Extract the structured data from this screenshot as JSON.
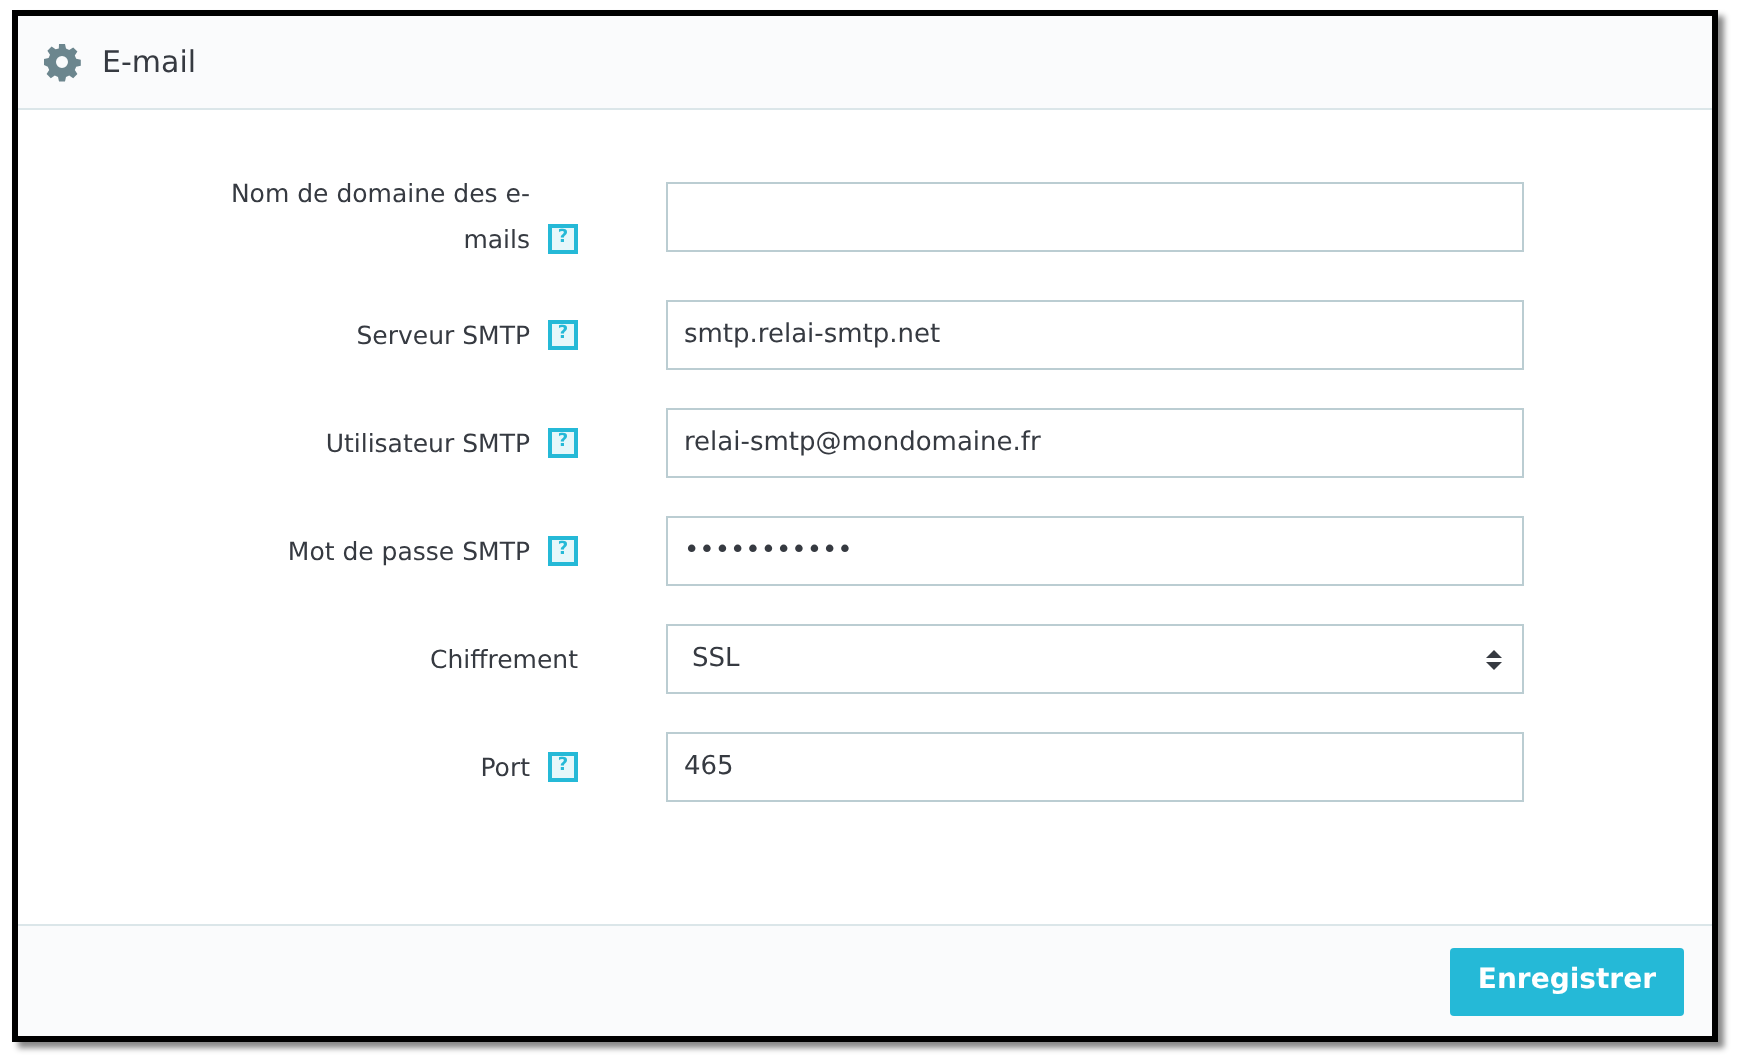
{
  "panel": {
    "title": "E-mail"
  },
  "fields": [
    {
      "kind": "text",
      "label": "Nom de domaine des e-mails",
      "help": "?"
    },
    {
      "kind": "text",
      "label": "Serveur SMTP",
      "help": "?",
      "value": "smtp.relai-smtp.net"
    },
    {
      "kind": "text",
      "label": "Utilisateur SMTP",
      "help": "?",
      "value": "relai-smtp@mondomaine.fr"
    },
    {
      "kind": "password",
      "label": "Mot de passe SMTP",
      "help": "?",
      "value": "•••••••••••"
    },
    {
      "kind": "select",
      "label": "Chiffrement",
      "value": "SSL"
    },
    {
      "kind": "text",
      "label": "Port",
      "help": "?",
      "value": "465"
    }
  ],
  "footer": {
    "button": "Enregistrer"
  }
}
